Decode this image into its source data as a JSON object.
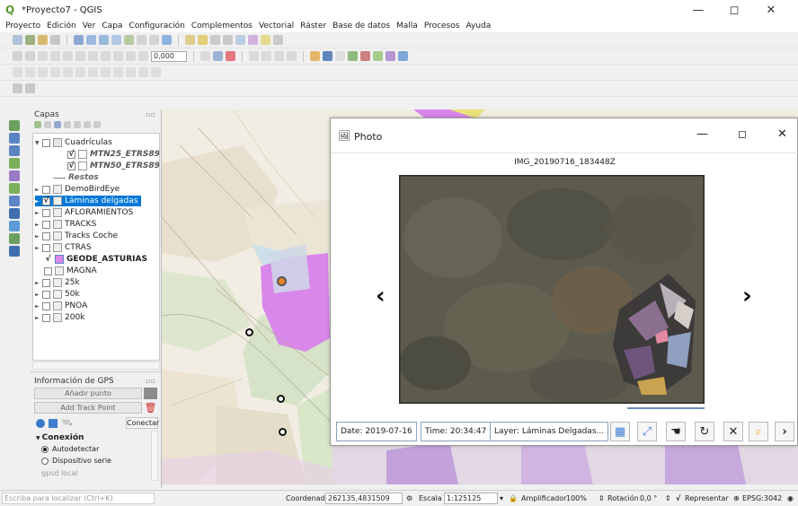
{
  "window": {
    "title": "*Proyecto7 - QGIS",
    "minimize": "—",
    "maximize": "◻",
    "close": "✕"
  },
  "menu": [
    "Proyecto",
    "Edición",
    "Ver",
    "Capa",
    "Configuración",
    "Complementos",
    "Vectorial",
    "Ráster",
    "Base de datos",
    "Malla",
    "Procesos",
    "Ayuda"
  ],
  "toolbar": {
    "scale_value": "0,000"
  },
  "layers_panel": {
    "title": "Capas",
    "items": [
      {
        "label": "Cuadrículas",
        "checked": false,
        "expanded": true
      },
      {
        "label": "MTN25_ETRS89",
        "checked": true
      },
      {
        "label": "MTN50_ETRS89",
        "checked": true
      },
      {
        "label": "Restos"
      },
      {
        "label": "DemoBirdEye",
        "checked": false
      },
      {
        "label": "Láminas delgadas",
        "checked": true,
        "selected": true
      },
      {
        "label": "AFLORAMIENTOS",
        "checked": false
      },
      {
        "label": "TRACKS",
        "checked": false
      },
      {
        "label": "Tracks Coche",
        "checked": false
      },
      {
        "label": "CTRAS",
        "checked": false
      },
      {
        "label": "GEODE_ASTURIAS",
        "checked": true
      },
      {
        "label": "MAGNA",
        "checked": false
      },
      {
        "label": "25k",
        "checked": false
      },
      {
        "label": "50k",
        "checked": false
      },
      {
        "label": "PNOA",
        "checked": false
      },
      {
        "label": "200k",
        "checked": false
      }
    ]
  },
  "gps_panel": {
    "title": "Información de GPS",
    "add_point": "Añadir punto",
    "add_track_point": "Add Track Point",
    "connect": "Conectar",
    "section": "Conexión",
    "autodetect": "Autodetectar",
    "serial": "Dispositivo serie",
    "gpsd": "gpsd local"
  },
  "photo_dialog": {
    "title": "Photo",
    "image_name": "IMG_20190716_183448Z",
    "date": "Date: 2019-07-16",
    "time": "Time: 20:34:47",
    "layer": "Layer: Láminas Delgadas...",
    "prev": "‹",
    "next": "›",
    "tool_next": "›"
  },
  "statusbar": {
    "search_placeholder": "Escriba para localizar (Ctrl+K)",
    "coord_label": "Coordenada",
    "coord_value": "262135,4831509",
    "scale_label": "Escala",
    "scale_value": "1:125125",
    "magnifier_label": "Amplificador",
    "magnifier_value": "100%",
    "rotation_label": "Rotación",
    "rotation_value": "0,0 °",
    "render_label": "Representar",
    "crs": "EPSG:3042"
  },
  "colors": {
    "accent": "#0078d7",
    "map_purple": "#d987ea",
    "map_orange": "#e8852a"
  }
}
